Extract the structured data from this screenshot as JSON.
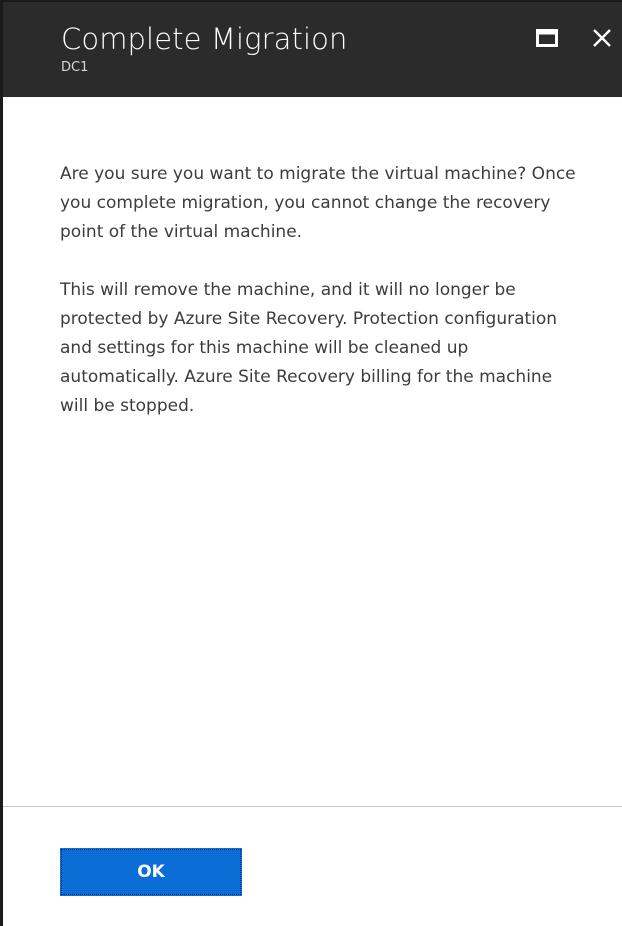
{
  "header": {
    "title": "Complete Migration",
    "subtitle": "DC1",
    "maximize_icon": "maximize-icon",
    "close_icon": "close-icon"
  },
  "content": {
    "paragraph1": "Are you sure you want to migrate the virtual machine? Once you complete migration, you cannot change the recovery point of the virtual machine.",
    "paragraph2": "This will remove the machine, and it will no longer be protected by Azure Site Recovery. Protection configuration and settings for this machine will be cleaned up automatically. Azure Site Recovery billing for the machine will be stopped."
  },
  "footer": {
    "ok_label": "OK"
  },
  "colors": {
    "header_bg": "#2b2b2b",
    "accent": "#0b6ed6",
    "text": "#3c3c3c"
  }
}
